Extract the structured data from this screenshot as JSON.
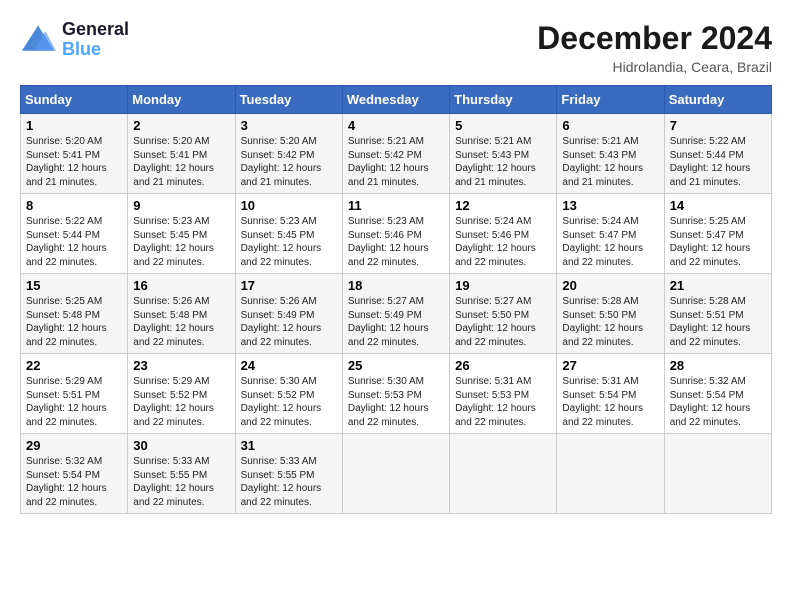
{
  "logo": {
    "line1": "General",
    "line2": "Blue"
  },
  "title": "December 2024",
  "subtitle": "Hidrolandia, Ceara, Brazil",
  "days_of_week": [
    "Sunday",
    "Monday",
    "Tuesday",
    "Wednesday",
    "Thursday",
    "Friday",
    "Saturday"
  ],
  "weeks": [
    [
      {
        "day": "1",
        "info": "Sunrise: 5:20 AM\nSunset: 5:41 PM\nDaylight: 12 hours\nand 21 minutes."
      },
      {
        "day": "2",
        "info": "Sunrise: 5:20 AM\nSunset: 5:41 PM\nDaylight: 12 hours\nand 21 minutes."
      },
      {
        "day": "3",
        "info": "Sunrise: 5:20 AM\nSunset: 5:42 PM\nDaylight: 12 hours\nand 21 minutes."
      },
      {
        "day": "4",
        "info": "Sunrise: 5:21 AM\nSunset: 5:42 PM\nDaylight: 12 hours\nand 21 minutes."
      },
      {
        "day": "5",
        "info": "Sunrise: 5:21 AM\nSunset: 5:43 PM\nDaylight: 12 hours\nand 21 minutes."
      },
      {
        "day": "6",
        "info": "Sunrise: 5:21 AM\nSunset: 5:43 PM\nDaylight: 12 hours\nand 21 minutes."
      },
      {
        "day": "7",
        "info": "Sunrise: 5:22 AM\nSunset: 5:44 PM\nDaylight: 12 hours\nand 21 minutes."
      }
    ],
    [
      {
        "day": "8",
        "info": "Sunrise: 5:22 AM\nSunset: 5:44 PM\nDaylight: 12 hours\nand 22 minutes."
      },
      {
        "day": "9",
        "info": "Sunrise: 5:23 AM\nSunset: 5:45 PM\nDaylight: 12 hours\nand 22 minutes."
      },
      {
        "day": "10",
        "info": "Sunrise: 5:23 AM\nSunset: 5:45 PM\nDaylight: 12 hours\nand 22 minutes."
      },
      {
        "day": "11",
        "info": "Sunrise: 5:23 AM\nSunset: 5:46 PM\nDaylight: 12 hours\nand 22 minutes."
      },
      {
        "day": "12",
        "info": "Sunrise: 5:24 AM\nSunset: 5:46 PM\nDaylight: 12 hours\nand 22 minutes."
      },
      {
        "day": "13",
        "info": "Sunrise: 5:24 AM\nSunset: 5:47 PM\nDaylight: 12 hours\nand 22 minutes."
      },
      {
        "day": "14",
        "info": "Sunrise: 5:25 AM\nSunset: 5:47 PM\nDaylight: 12 hours\nand 22 minutes."
      }
    ],
    [
      {
        "day": "15",
        "info": "Sunrise: 5:25 AM\nSunset: 5:48 PM\nDaylight: 12 hours\nand 22 minutes."
      },
      {
        "day": "16",
        "info": "Sunrise: 5:26 AM\nSunset: 5:48 PM\nDaylight: 12 hours\nand 22 minutes."
      },
      {
        "day": "17",
        "info": "Sunrise: 5:26 AM\nSunset: 5:49 PM\nDaylight: 12 hours\nand 22 minutes."
      },
      {
        "day": "18",
        "info": "Sunrise: 5:27 AM\nSunset: 5:49 PM\nDaylight: 12 hours\nand 22 minutes."
      },
      {
        "day": "19",
        "info": "Sunrise: 5:27 AM\nSunset: 5:50 PM\nDaylight: 12 hours\nand 22 minutes."
      },
      {
        "day": "20",
        "info": "Sunrise: 5:28 AM\nSunset: 5:50 PM\nDaylight: 12 hours\nand 22 minutes."
      },
      {
        "day": "21",
        "info": "Sunrise: 5:28 AM\nSunset: 5:51 PM\nDaylight: 12 hours\nand 22 minutes."
      }
    ],
    [
      {
        "day": "22",
        "info": "Sunrise: 5:29 AM\nSunset: 5:51 PM\nDaylight: 12 hours\nand 22 minutes."
      },
      {
        "day": "23",
        "info": "Sunrise: 5:29 AM\nSunset: 5:52 PM\nDaylight: 12 hours\nand 22 minutes."
      },
      {
        "day": "24",
        "info": "Sunrise: 5:30 AM\nSunset: 5:52 PM\nDaylight: 12 hours\nand 22 minutes."
      },
      {
        "day": "25",
        "info": "Sunrise: 5:30 AM\nSunset: 5:53 PM\nDaylight: 12 hours\nand 22 minutes."
      },
      {
        "day": "26",
        "info": "Sunrise: 5:31 AM\nSunset: 5:53 PM\nDaylight: 12 hours\nand 22 minutes."
      },
      {
        "day": "27",
        "info": "Sunrise: 5:31 AM\nSunset: 5:54 PM\nDaylight: 12 hours\nand 22 minutes."
      },
      {
        "day": "28",
        "info": "Sunrise: 5:32 AM\nSunset: 5:54 PM\nDaylight: 12 hours\nand 22 minutes."
      }
    ],
    [
      {
        "day": "29",
        "info": "Sunrise: 5:32 AM\nSunset: 5:54 PM\nDaylight: 12 hours\nand 22 minutes."
      },
      {
        "day": "30",
        "info": "Sunrise: 5:33 AM\nSunset: 5:55 PM\nDaylight: 12 hours\nand 22 minutes."
      },
      {
        "day": "31",
        "info": "Sunrise: 5:33 AM\nSunset: 5:55 PM\nDaylight: 12 hours\nand 22 minutes."
      },
      {
        "day": "",
        "info": ""
      },
      {
        "day": "",
        "info": ""
      },
      {
        "day": "",
        "info": ""
      },
      {
        "day": "",
        "info": ""
      }
    ]
  ]
}
